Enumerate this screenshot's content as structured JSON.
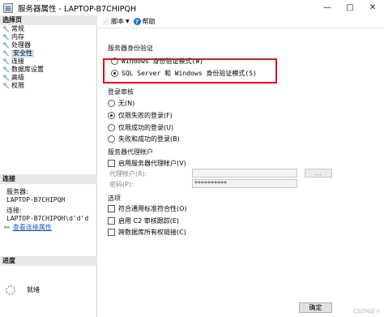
{
  "window": {
    "title": "服务器属性 - LAPTOP-B7CHIPQH",
    "minimize_glyph": "—",
    "maximize_glyph": "□",
    "close_glyph": "✕"
  },
  "left": {
    "select_page_header": "选择页",
    "nav_items": [
      {
        "label": "常规"
      },
      {
        "label": "内存"
      },
      {
        "label": "处理器"
      },
      {
        "label": "安全性"
      },
      {
        "label": "连接"
      },
      {
        "label": "数据库设置"
      },
      {
        "label": "高级"
      },
      {
        "label": "权限"
      }
    ],
    "active_index": 3,
    "connection_header": "连接",
    "server_label": "服务器:",
    "server_value": "LAPTOP-B7CHIPQH",
    "connection_label": "连接:",
    "connection_value": "LAPTOP-B7CHIPQH\\d'd'd",
    "view_connection_link": "查看连接属性",
    "progress_header": "进度",
    "progress_status": "就绪"
  },
  "toolbar": {
    "script_label": "脚本",
    "help_label": "帮助"
  },
  "auth": {
    "title": "服务器身份验证",
    "options": [
      {
        "label": "Windows 身份验证模式(W)",
        "checked": false
      },
      {
        "label": "SQL Server 和 Windows 身份验证模式(S)",
        "checked": true
      }
    ]
  },
  "audit": {
    "title": "登录审核",
    "options": [
      {
        "label": "无(N)",
        "checked": false
      },
      {
        "label": "仅限失败的登录(F)",
        "checked": true
      },
      {
        "label": "仅限成功的登录(U)",
        "checked": false
      },
      {
        "label": "失败和成功的登录(B)",
        "checked": false
      }
    ]
  },
  "proxy": {
    "title": "服务器代理帐户",
    "enable_label": "启用服务器代理帐户(V)",
    "account_label": "代理帐户(R):",
    "account_value": "",
    "password_label": "密码(P):",
    "password_value": "**********",
    "browse_label": "..."
  },
  "options": {
    "title": "选项",
    "items": [
      {
        "label": "符合通用标准符合性(O)",
        "checked": false
      },
      {
        "label": "启用 C2 审核跟踪(E)",
        "checked": false
      },
      {
        "label": "跨数据库所有权链接(C)",
        "checked": false
      }
    ]
  },
  "footer": {
    "ok_label": "确定",
    "watermark": "CSDN@卜"
  }
}
